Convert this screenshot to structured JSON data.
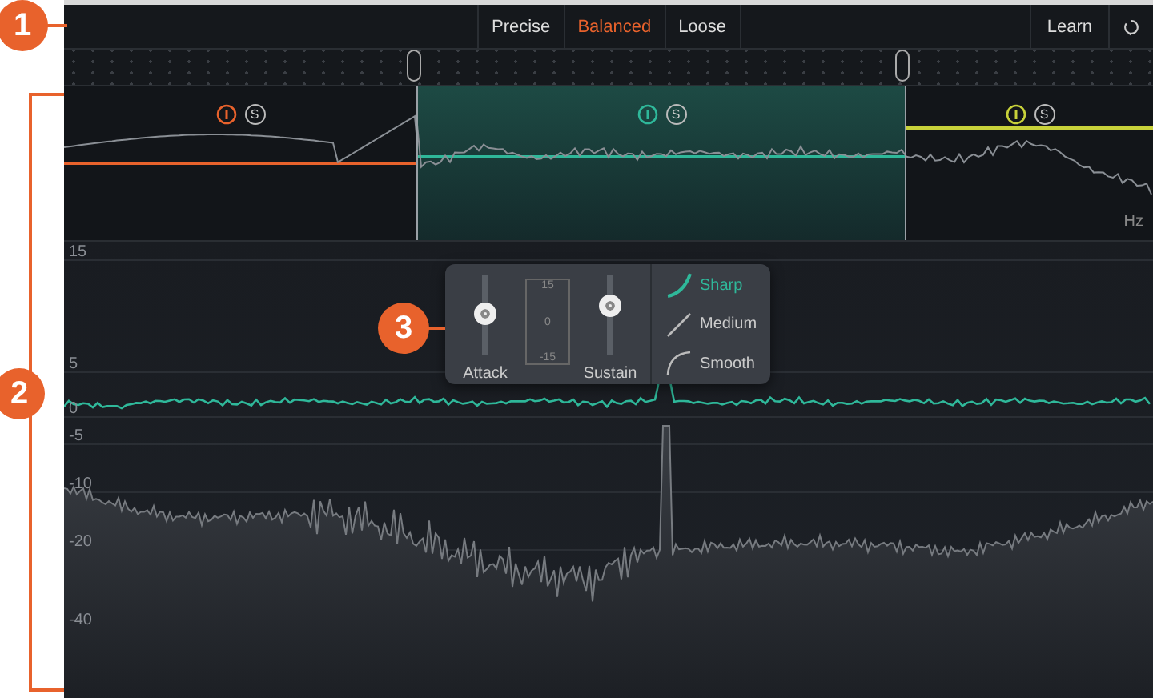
{
  "toolbar": {
    "modes": [
      {
        "label": "Precise",
        "selected": false
      },
      {
        "label": "Balanced",
        "selected": true
      },
      {
        "label": "Loose",
        "selected": false
      }
    ],
    "learn": "Learn"
  },
  "bands": [
    {
      "color": "#e8622c",
      "selected": false,
      "solo": "S"
    },
    {
      "color": "#2fb89a",
      "selected": true,
      "solo": "S"
    },
    {
      "color": "#c8d23a",
      "selected": false,
      "solo": "S"
    }
  ],
  "band_axis_label": "Hz",
  "graph": {
    "y_labels": [
      "15",
      "5",
      "0",
      "-5",
      "-10",
      "-20",
      "-40"
    ]
  },
  "popup": {
    "attack": {
      "label": "Attack",
      "level": 0.52
    },
    "sustain": {
      "label": "Sustain",
      "level": 0.68
    },
    "scale": [
      "15",
      "0",
      "-15"
    ],
    "shapes": [
      {
        "label": "Sharp",
        "kind": "sharp",
        "selected": true
      },
      {
        "label": "Medium",
        "kind": "medium",
        "selected": false
      },
      {
        "label": "Smooth",
        "kind": "smooth",
        "selected": false
      }
    ]
  },
  "callouts": [
    "1",
    "2",
    "3"
  ]
}
